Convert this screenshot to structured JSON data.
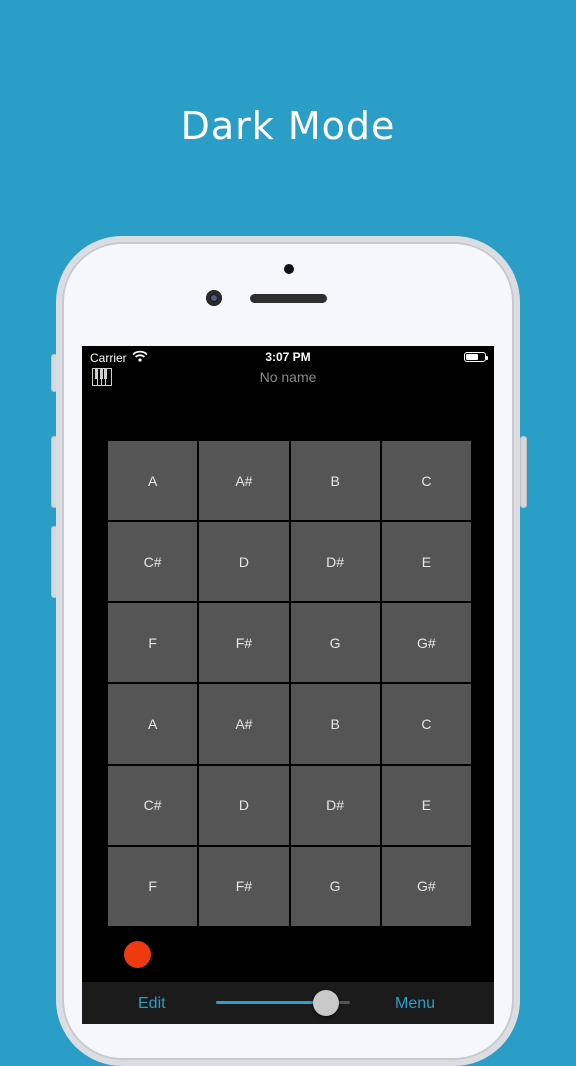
{
  "promo": {
    "headline": "Dark Mode"
  },
  "status_bar": {
    "carrier": "Carrier",
    "time": "3:07 PM"
  },
  "header": {
    "title": "No name",
    "left_icon": "piano-keyboard-icon"
  },
  "pads": [
    "A",
    "A#",
    "B",
    "C",
    "C#",
    "D",
    "D#",
    "E",
    "F",
    "F#",
    "G",
    "G#",
    "A",
    "A#",
    "B",
    "C",
    "C#",
    "D",
    "D#",
    "E",
    "F",
    "F#",
    "G",
    "G#"
  ],
  "record": {
    "color": "#ee3a0e"
  },
  "bottom_bar": {
    "edit_label": "Edit",
    "menu_label": "Menu",
    "slider_value": 0.82
  },
  "colors": {
    "accent": "#2a9ec6",
    "pad": "#555555",
    "screen": "#000000"
  }
}
